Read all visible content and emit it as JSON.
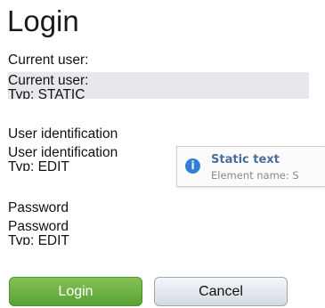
{
  "title": "Login",
  "current_user": {
    "label": "Current user:",
    "field_label": "Current user:",
    "field_type": "Typ: STATIC"
  },
  "user_identification": {
    "label": "User identification",
    "field_label": "User identification",
    "field_type": "Typ: EDIT"
  },
  "tooltip": {
    "icon": "info-icon",
    "title": "Static text",
    "subtitle": "Element name: S"
  },
  "password": {
    "label": "Password",
    "field_label": "Password",
    "field_type": "Typ: EDIT"
  },
  "buttons": {
    "login": "Login",
    "cancel": "Cancel"
  },
  "colors": {
    "login_green": "#6fb246",
    "readonly_bg": "#e6e8ec",
    "info_blue": "#2f7fd6"
  }
}
